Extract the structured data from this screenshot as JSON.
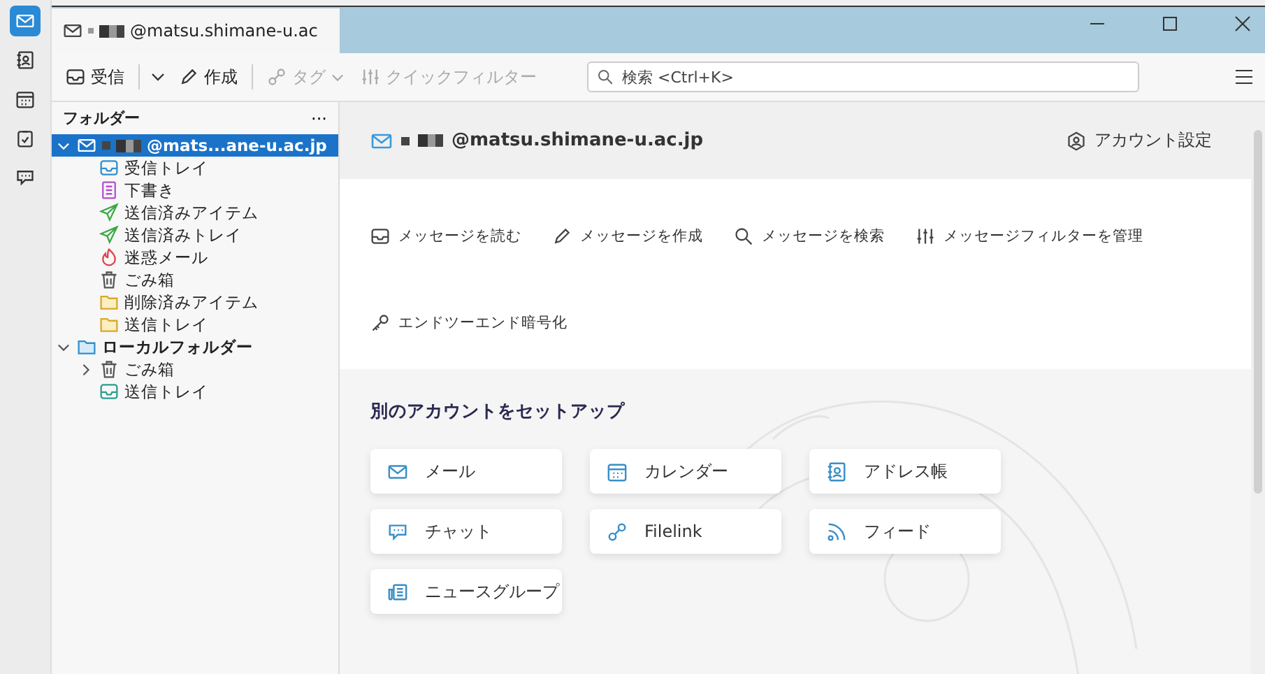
{
  "spaces": [
    {
      "kind": "mail",
      "selected": true
    },
    {
      "kind": "addressbook",
      "selected": false
    },
    {
      "kind": "calendar",
      "selected": false
    },
    {
      "kind": "tasks",
      "selected": false
    },
    {
      "kind": "chat",
      "selected": false
    }
  ],
  "tab": {
    "title": "@matsu.shimane-u.ac"
  },
  "toolbar": {
    "get_messages": "受信",
    "write": "作成",
    "tag": "タグ",
    "quick_filter": "クイックフィルター",
    "search": {
      "placeholder": "検索 <Ctrl+K>"
    }
  },
  "folder_pane": {
    "title": "フォルダー",
    "menu": "···",
    "tree": [
      {
        "kind": "account",
        "label": "@mats...ane-u.ac.jp",
        "selected": true,
        "expanded": true,
        "children": [
          {
            "kind": "inbox",
            "label": "受信トレイ",
            "selected": false
          },
          {
            "kind": "drafts",
            "label": "下書き",
            "selected": false
          },
          {
            "kind": "sent",
            "label": "送信済みアイテム",
            "selected": false
          },
          {
            "kind": "sent",
            "label": "送信済みトレイ",
            "selected": false
          },
          {
            "kind": "junk",
            "label": "迷惑メール",
            "selected": false
          },
          {
            "kind": "trash",
            "label": "ごみ箱",
            "selected": false
          },
          {
            "kind": "folder",
            "label": "削除済みアイテム",
            "selected": false
          },
          {
            "kind": "folder",
            "label": "送信トレイ",
            "selected": false
          }
        ]
      },
      {
        "kind": "local",
        "label": "ローカルフォルダー",
        "selected": false,
        "expanded": true,
        "children": [
          {
            "kind": "trash",
            "label": "ごみ箱",
            "selected": false,
            "expanded": false
          },
          {
            "kind": "outbox",
            "label": "送信トレイ",
            "selected": false
          }
        ]
      }
    ]
  },
  "account_hub": {
    "email": "@matsu.shimane-u.ac.jp",
    "settings": "アカウント設定",
    "actions": [
      {
        "kind": "read",
        "label": "メッセージを読む"
      },
      {
        "kind": "write",
        "label": "メッセージを作成"
      },
      {
        "kind": "search",
        "label": "メッセージを検索"
      },
      {
        "kind": "filter",
        "label": "メッセージフィルターを管理"
      },
      {
        "kind": "key",
        "label": "エンドツーエンド暗号化"
      }
    ],
    "setup_title": "別のアカウントをセットアップ",
    "setup_items": [
      {
        "kind": "mail",
        "label": "メール"
      },
      {
        "kind": "calendar",
        "label": "カレンダー"
      },
      {
        "kind": "addressbook",
        "label": "アドレス帳"
      },
      {
        "kind": "chat",
        "label": "チャット"
      },
      {
        "kind": "link",
        "label": "Filelink"
      },
      {
        "kind": "feed",
        "label": "フィード"
      },
      {
        "kind": "news",
        "label": "ニュースグループ"
      }
    ]
  }
}
